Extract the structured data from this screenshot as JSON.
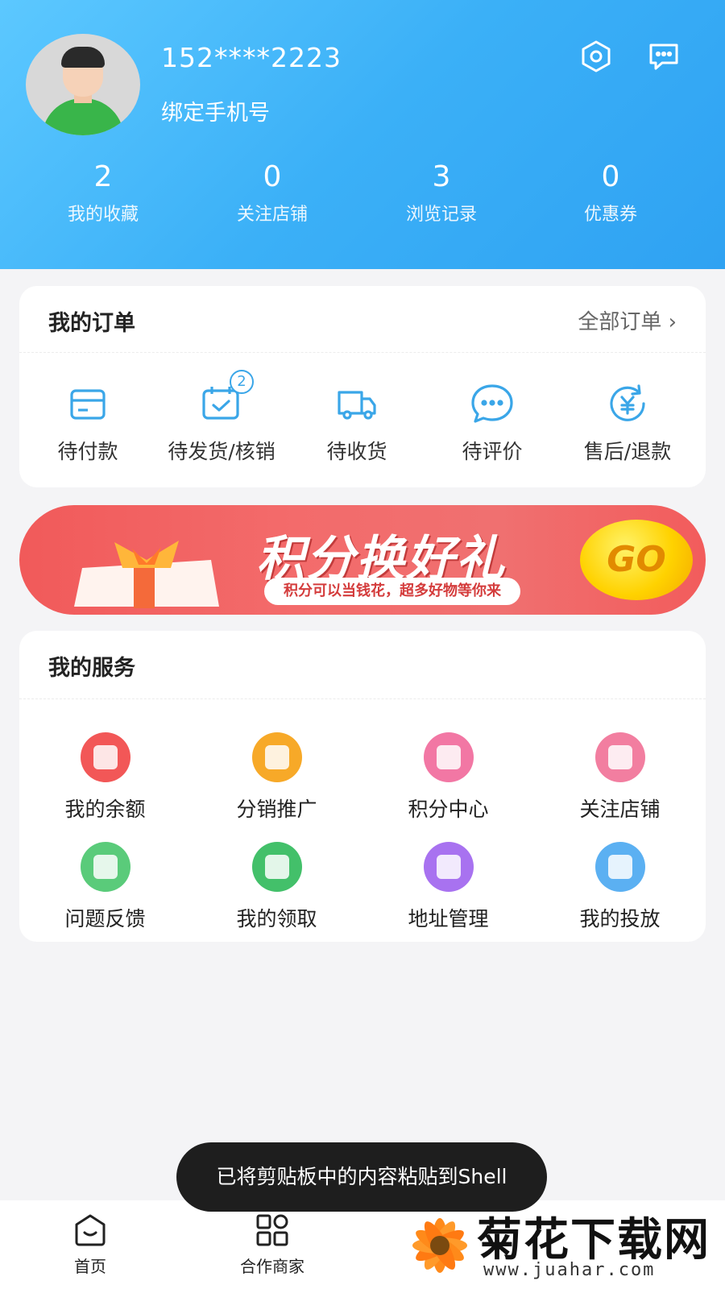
{
  "header": {
    "phone": "152****2223",
    "bind_phone_label": "绑定手机号",
    "stats": [
      {
        "num": "2",
        "label": "我的收藏"
      },
      {
        "num": "0",
        "label": "关注店铺"
      },
      {
        "num": "3",
        "label": "浏览记录"
      },
      {
        "num": "0",
        "label": "优惠券"
      }
    ],
    "icons": [
      "settings-icon",
      "message-icon"
    ]
  },
  "orders": {
    "title": "我的订单",
    "all_label": "全部订单 ›",
    "items": [
      {
        "label": "待付款",
        "icon": "wallet-icon"
      },
      {
        "label": "待发货/核销",
        "icon": "ship-check-icon",
        "badge": "2"
      },
      {
        "label": "待收货",
        "icon": "truck-icon"
      },
      {
        "label": "待评价",
        "icon": "comment-icon"
      },
      {
        "label": "售后/退款",
        "icon": "refund-icon"
      }
    ]
  },
  "banner": {
    "title": "积分换好礼",
    "subtitle": "积分可以当钱花，超多好物等你来",
    "go": "GO"
  },
  "services": {
    "title": "我的服务",
    "items": [
      {
        "label": "我的余额",
        "color": "#f25757"
      },
      {
        "label": "分销推广",
        "color": "#f7a928"
      },
      {
        "label": "积分中心",
        "color": "#f277a4"
      },
      {
        "label": "关注店铺",
        "color": "#f27ea0"
      },
      {
        "label": "问题反馈",
        "color": "#5acb7a"
      },
      {
        "label": "我的领取",
        "color": "#43c06a"
      },
      {
        "label": "地址管理",
        "color": "#a872f0"
      },
      {
        "label": "我的投放",
        "color": "#5bb0f2"
      }
    ]
  },
  "tabbar": {
    "items": [
      {
        "label": "首页"
      },
      {
        "label": "合作商家"
      }
    ]
  },
  "toast": "已将剪贴板中的内容粘贴到Shell",
  "watermark": {
    "title": "菊花下载网",
    "url": "www.juahar.com"
  },
  "colors": {
    "header_gradient_start": "#5cc8ff",
    "header_gradient_end": "#2fa2f2",
    "icon_blue": "#3aa6e8"
  }
}
